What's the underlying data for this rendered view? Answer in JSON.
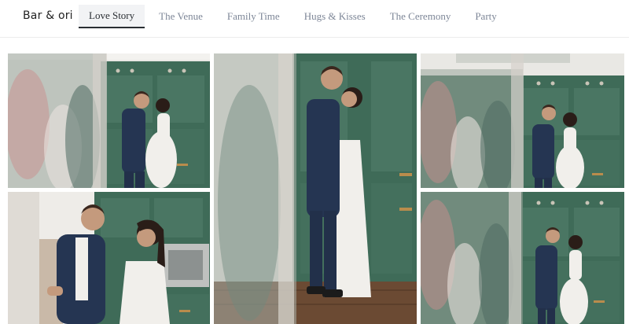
{
  "header": {
    "brand": "Bar & ori",
    "tabs": [
      {
        "label": "Love Story",
        "active": true
      },
      {
        "label": "The Venue",
        "active": false
      },
      {
        "label": "Family Time",
        "active": false
      },
      {
        "label": "Hugs & Kisses",
        "active": false
      },
      {
        "label": "The Ceremony",
        "active": false
      },
      {
        "label": "Party",
        "active": false
      }
    ]
  },
  "gallery": {
    "photos": [
      {
        "scene": "couple-embrace-kitchen-blurred-foreground"
      },
      {
        "scene": "couple-standing-tall-green-cabinets"
      },
      {
        "scene": "couple-embrace-kitchen-blurred-foreground"
      },
      {
        "scene": "couple-laughing-kitchen"
      },
      {
        "scene": "couple-embrace-kitchen-blurred-foreground"
      }
    ]
  },
  "colors": {
    "cabinet_green": "#3f6b58",
    "suit_navy": "#253552",
    "dress_white": "#f1efeb",
    "wall_white": "#e9e8e4",
    "floor_wood": "#6b4a33",
    "active_tab_bg": "#f2f3f5",
    "inactive_tab_text": "#7d8697"
  }
}
